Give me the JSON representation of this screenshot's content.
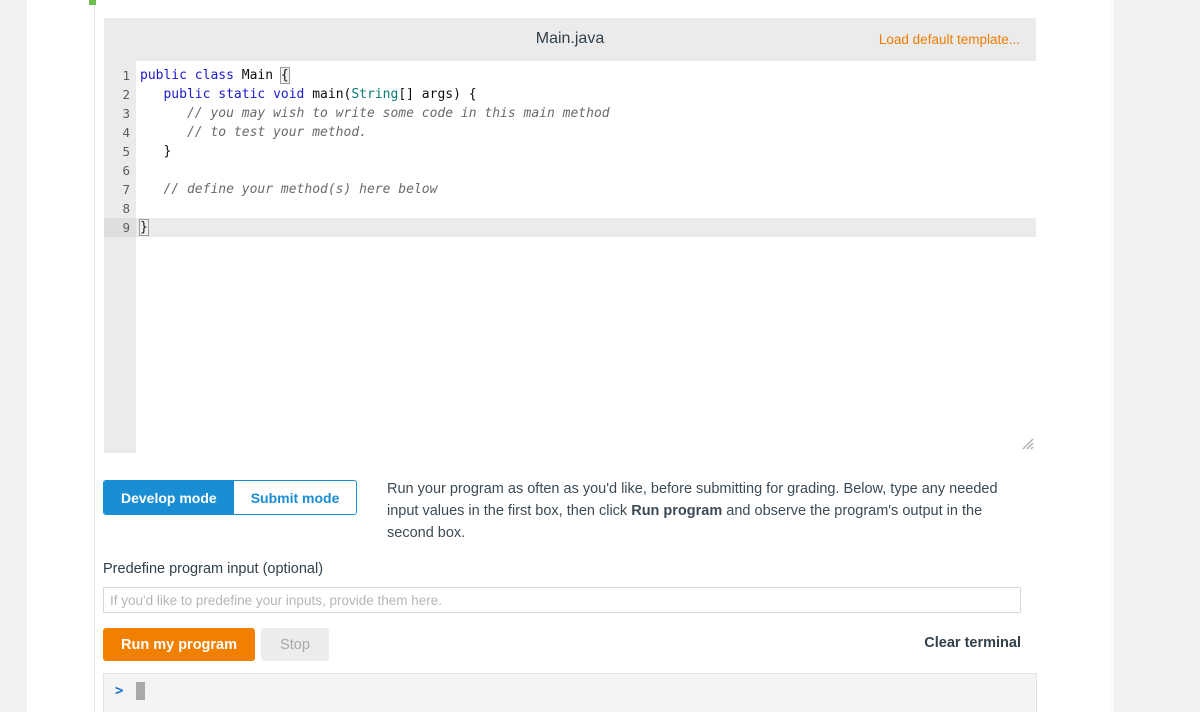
{
  "editor": {
    "filename": "Main.java",
    "load_template_label": "Load default template...",
    "accent_orange": "#f07d00",
    "active_line": 9,
    "lines": [
      {
        "n": "1",
        "tokens": [
          {
            "t": "public",
            "c": "kw"
          },
          {
            "t": " ",
            "c": "txt"
          },
          {
            "t": "class",
            "c": "kw"
          },
          {
            "t": " Main ",
            "c": "txt"
          },
          {
            "t": "{",
            "c": "brace-match"
          }
        ]
      },
      {
        "n": "2",
        "tokens": [
          {
            "t": "   ",
            "c": "txt"
          },
          {
            "t": "public",
            "c": "kw"
          },
          {
            "t": " ",
            "c": "txt"
          },
          {
            "t": "static",
            "c": "kw"
          },
          {
            "t": " ",
            "c": "txt"
          },
          {
            "t": "void",
            "c": "kw"
          },
          {
            "t": " main(",
            "c": "txt"
          },
          {
            "t": "String",
            "c": "type"
          },
          {
            "t": "[] args) {",
            "c": "txt"
          }
        ]
      },
      {
        "n": "3",
        "tokens": [
          {
            "t": "      ",
            "c": "txt"
          },
          {
            "t": "// you may wish to write some code in this main method",
            "c": "com"
          }
        ]
      },
      {
        "n": "4",
        "tokens": [
          {
            "t": "      ",
            "c": "txt"
          },
          {
            "t": "// to test your method.",
            "c": "com"
          }
        ]
      },
      {
        "n": "5",
        "tokens": [
          {
            "t": "   }",
            "c": "txt"
          }
        ]
      },
      {
        "n": "6",
        "tokens": []
      },
      {
        "n": "7",
        "tokens": [
          {
            "t": "   ",
            "c": "txt"
          },
          {
            "t": "// define your method(s) here below",
            "c": "com"
          }
        ]
      },
      {
        "n": "8",
        "tokens": []
      },
      {
        "n": "9",
        "tokens": [
          {
            "t": "}",
            "c": "brace-match"
          }
        ]
      }
    ],
    "resize_grip_icon": "resize-handle-icon"
  },
  "mode_toggle": {
    "develop_label": "Develop mode",
    "submit_label": "Submit mode",
    "active": "Develop mode",
    "accent_blue": "#1a8ed4"
  },
  "instructions": {
    "part1": "Run your program as often as you'd like, before submitting for grading. Below, type any needed input values in the first box, then click ",
    "bold": "Run program",
    "part2": " and observe the program's output in the second box."
  },
  "program_input": {
    "label": "Predefine program input (optional)",
    "placeholder": "If you'd like to predefine your inputs, provide them here.",
    "value": ""
  },
  "actions": {
    "run_label": "Run my program",
    "stop_label": "Stop",
    "clear_terminal_label": "Clear terminal",
    "run_color": "#f28000"
  },
  "terminal": {
    "prompt": ">",
    "output": "",
    "cursor_visible": true
  }
}
